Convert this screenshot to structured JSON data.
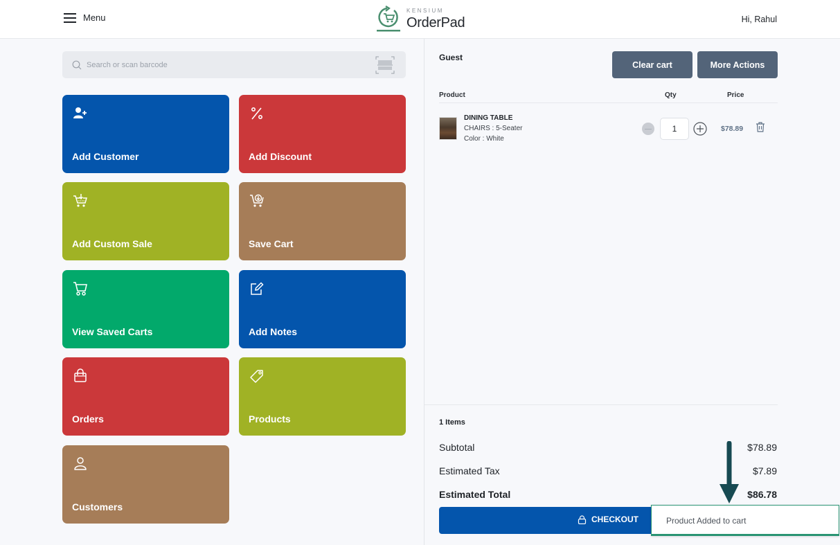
{
  "header": {
    "menu_label": "Menu",
    "logo_brand": "KENSIUM",
    "logo_name": "OrderPad",
    "greeting": "Hi, Rahul"
  },
  "search": {
    "placeholder": "Search or scan barcode",
    "value": ""
  },
  "tiles": [
    {
      "label": "Add Customer",
      "icon": "user-plus-icon",
      "color": "#0455ac"
    },
    {
      "label": "Add Discount",
      "icon": "percent-icon",
      "color": "#cb383a"
    },
    {
      "label": "Add Custom Sale",
      "icon": "cart-download-icon",
      "color": "#a0b225"
    },
    {
      "label": "Save Cart",
      "icon": "cart-save-icon",
      "color": "#a67d58"
    },
    {
      "label": "View Saved Carts",
      "icon": "cart-icon",
      "color": "#02a96b"
    },
    {
      "label": "Add Notes",
      "icon": "edit-note-icon",
      "color": "#0455ac"
    },
    {
      "label": "Orders",
      "icon": "shopping-bag-icon",
      "color": "#cb383a"
    },
    {
      "label": "Products",
      "icon": "tag-icon",
      "color": "#a0b225"
    },
    {
      "label": "Customers",
      "icon": "user-icon",
      "color": "#a67d58"
    }
  ],
  "cart": {
    "customer": "Guest",
    "clear_label": "Clear cart",
    "more_label": "More Actions",
    "columns": {
      "product": "Product",
      "qty": "Qty",
      "price": "Price"
    },
    "items": [
      {
        "name": "DINING TABLE",
        "options": [
          "CHAIRS : 5-Seater",
          "Color : White"
        ],
        "qty": "1",
        "price": "$78.89"
      }
    ],
    "items_count": "1 Items",
    "subtotal_label": "Subtotal",
    "subtotal": "$78.89",
    "tax_label": "Estimated Tax",
    "tax": "$7.89",
    "total_label": "Estimated Total",
    "total": "$86.78",
    "checkout_label": "CHECKOUT"
  },
  "toast": {
    "message": "Product Added to cart",
    "accent": "#2a9473"
  },
  "annotation": {
    "arrow_color": "#174a52"
  }
}
